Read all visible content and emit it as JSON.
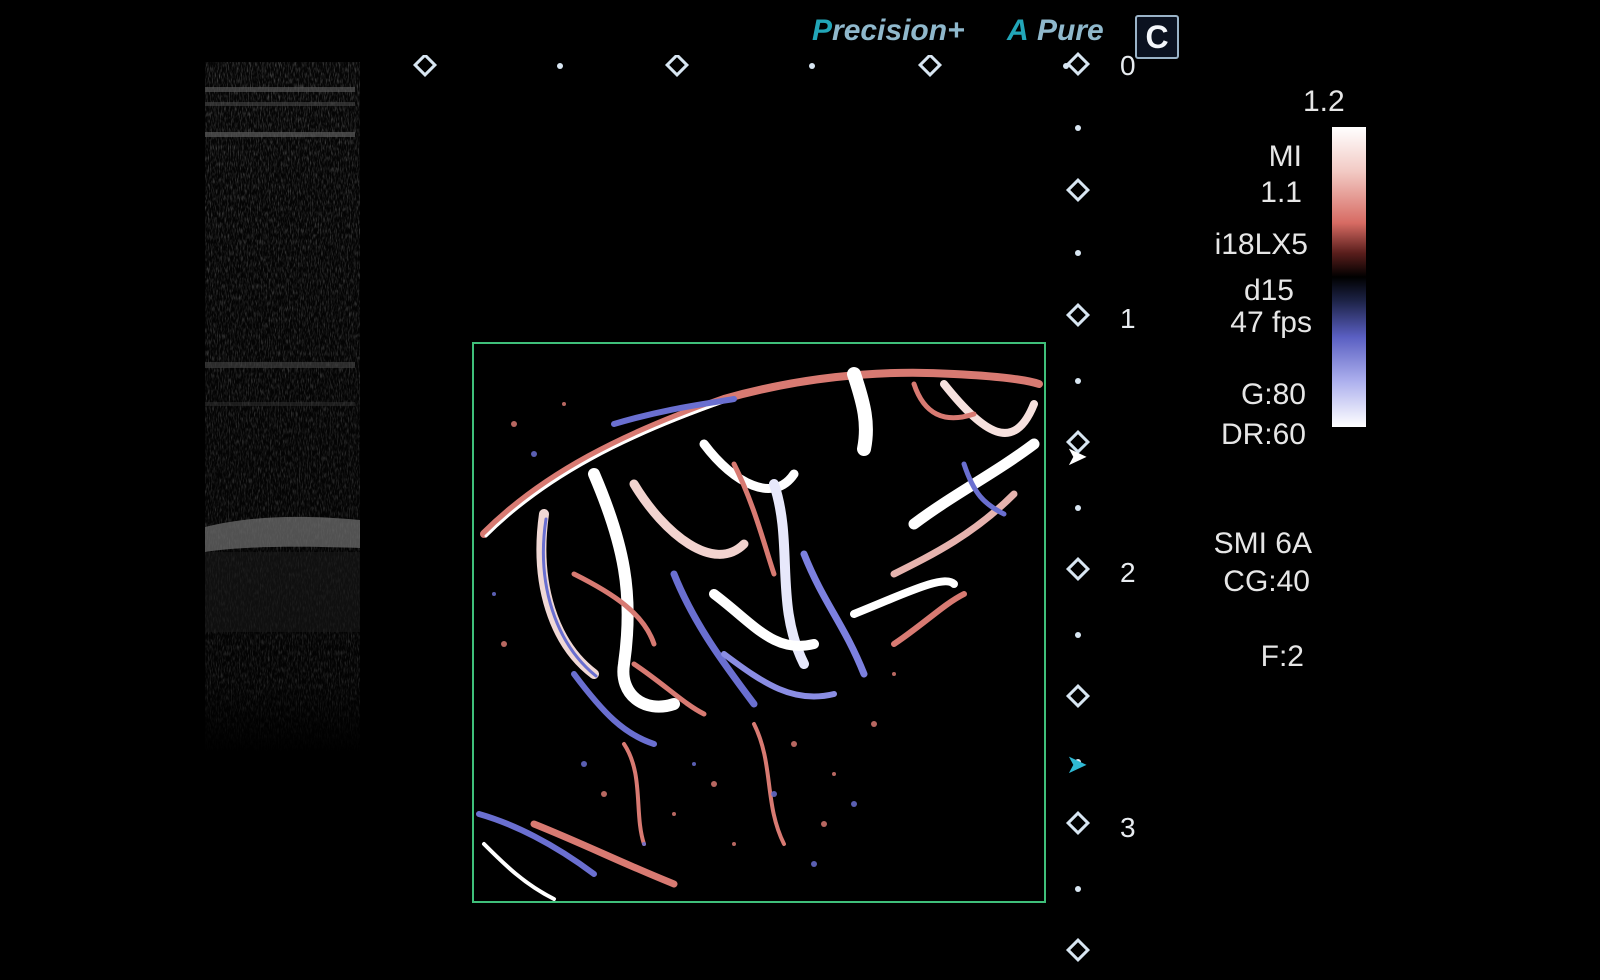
{
  "header": {
    "brand_precision": {
      "mark": "P",
      "text": "recision",
      "plus": "+"
    },
    "brand_pure": {
      "mark": "A",
      "text": "Pure"
    },
    "mode_badge": "C"
  },
  "depth_scale": {
    "labels": [
      "0",
      "1",
      "2",
      "3"
    ],
    "unit_marks": "diamond"
  },
  "markers": {
    "focus_arrow_color": "#ffffff",
    "range_arrow_color": "#2fb9d4"
  },
  "color_map": {
    "max_label": "1.2",
    "colors": [
      "#ffffff",
      "#d76b63",
      "#000000",
      "#5a5fc2",
      "#ffffff"
    ]
  },
  "info_panel": {
    "mi_label": "MI",
    "mi_value": "1.1",
    "probe": "i18LX5",
    "depth": "d15",
    "frame_rate": "47 fps",
    "gain": "G:80",
    "dynamic_range": "DR:60",
    "smi_mode": "SMI 6A",
    "color_gain": "CG:40",
    "focus": "F:2"
  },
  "colors": {
    "roi_border": "#3fbf7a",
    "brand_accent": "#22a6b8",
    "flow_red": "#d76b63",
    "flow_blue": "#5a5fc2"
  }
}
